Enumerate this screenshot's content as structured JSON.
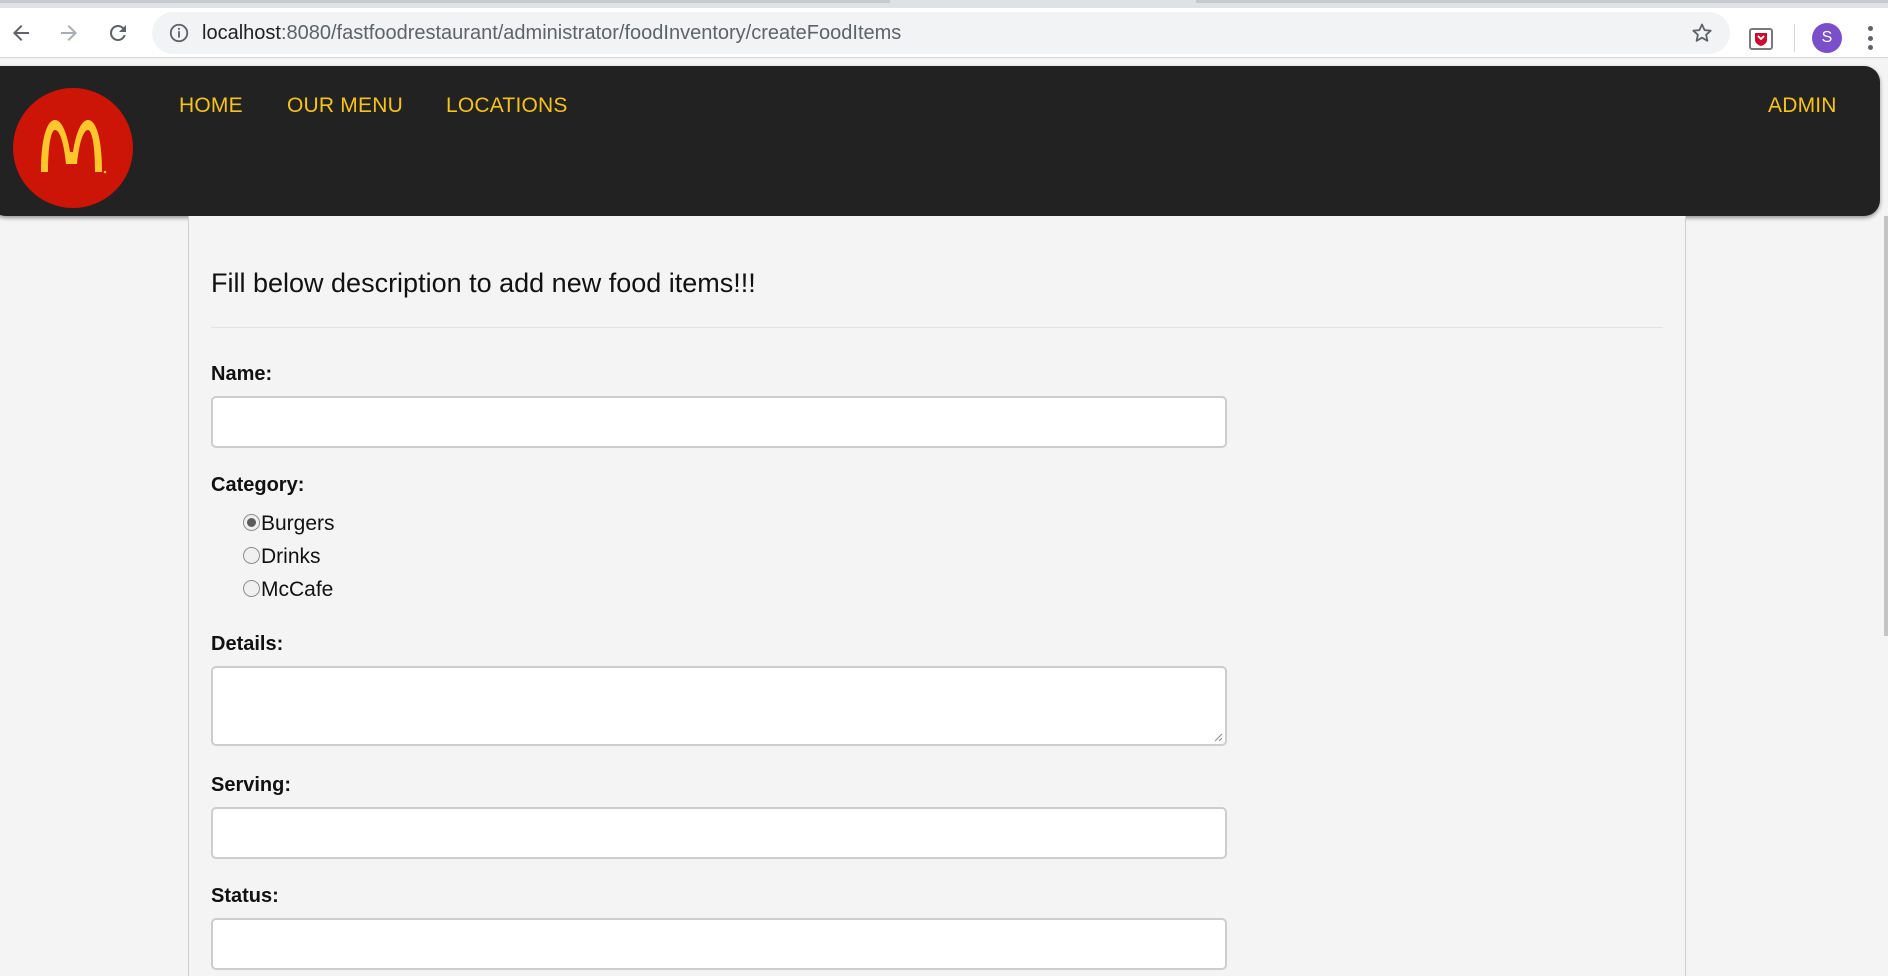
{
  "browser": {
    "url_host": "localhost",
    "url_path": ":8080/fastfoodrestaurant/administrator/foodInventory/createFoodItems",
    "profile_initial": "S"
  },
  "header": {
    "nav": [
      {
        "label": "HOME"
      },
      {
        "label": "OUR MENU"
      },
      {
        "label": "LOCATIONS"
      }
    ],
    "admin_label": "ADMIN"
  },
  "form": {
    "heading": "Fill below description to add new food items!!!",
    "name_label": "Name:",
    "name_value": "",
    "category_label": "Category:",
    "categories": [
      {
        "label": "Burgers",
        "checked": true
      },
      {
        "label": "Drinks",
        "checked": false
      },
      {
        "label": "McCafe",
        "checked": false
      }
    ],
    "details_label": "Details:",
    "details_value": "",
    "serving_label": "Serving:",
    "serving_value": "",
    "status_label": "Status:",
    "status_value": ""
  },
  "colors": {
    "header_bg": "#222222",
    "nav_text": "#f7c21a",
    "logo_red": "#cc1407",
    "logo_yellow": "#ffc72c",
    "page_bg": "#f4f4f4"
  },
  "icons": [
    "back-arrow-icon",
    "forward-arrow-icon",
    "reload-icon",
    "info-icon",
    "star-icon",
    "extension-shield-icon",
    "kebab-menu-icon",
    "golden-arches-logo"
  ]
}
